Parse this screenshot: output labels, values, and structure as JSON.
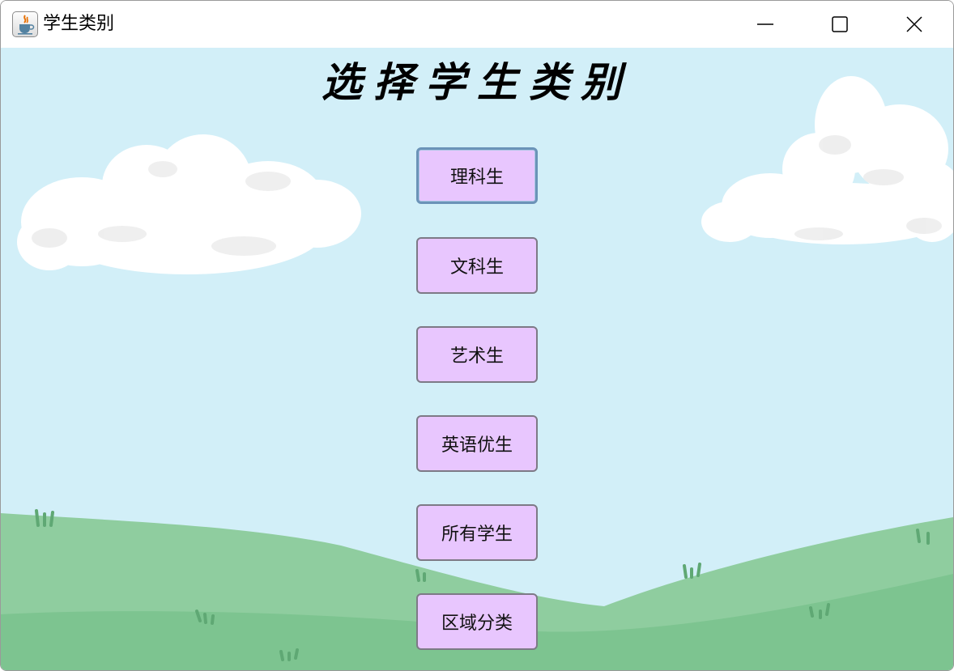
{
  "window": {
    "title": "学生类别",
    "app_icon": "java-cup-icon",
    "controls": [
      "minimize-icon",
      "maximize-icon",
      "close-icon"
    ]
  },
  "main": {
    "heading": "选择学生类别",
    "buttons": [
      {
        "label": "理科生",
        "focused": true
      },
      {
        "label": "文科生",
        "focused": false
      },
      {
        "label": "艺术生",
        "focused": false
      },
      {
        "label": "英语优生",
        "focused": false
      },
      {
        "label": "所有学生",
        "focused": false
      },
      {
        "label": "区域分类",
        "focused": false
      }
    ]
  },
  "colors": {
    "sky": "#d2eff8",
    "cloud": "#ffffff",
    "grass_light": "#8fcd9f",
    "grass_dark": "#78c28c",
    "button_bg": "#e8c6fe",
    "button_border": "#7d7a86",
    "focus_border": "#6b93b8"
  }
}
